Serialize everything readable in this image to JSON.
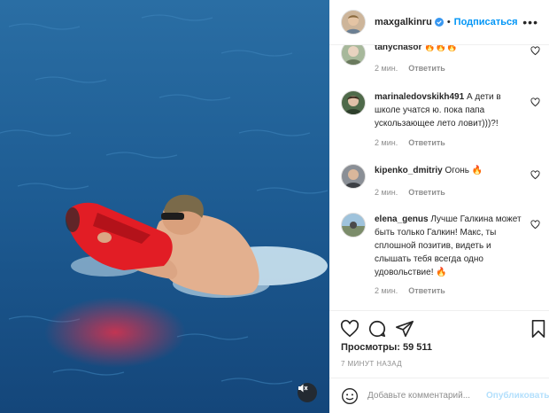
{
  "post": {
    "author": "maxgalkinru",
    "separator": "•",
    "follow_label": "Подписаться",
    "more_label": "•••"
  },
  "comments": [
    {
      "user": "tanychasor",
      "text": "🔥🔥🔥",
      "time": "2 мин.",
      "reply": "Ответить"
    },
    {
      "user": "marinaledovskikh491",
      "text": "А дети в школе учатся ю. пока папа ускользающее лето ловит)))?!",
      "time": "2 мин.",
      "reply": "Ответить"
    },
    {
      "user": "kipenko_dmitriy",
      "text": "Огонь 🔥",
      "time": "2 мин.",
      "reply": "Ответить"
    },
    {
      "user": "elena_genus",
      "text": "Лучше Галкина может быть только Галкин! Макс, ты сплошной позитив, видеть и слышать тебя всегда одно удовольствие! 🔥",
      "time": "2 мин.",
      "reply": "Ответить"
    }
  ],
  "stats": {
    "views_label": "Просмотры:",
    "views_value": "59 511",
    "posted": "7 МИНУТ НАЗАД"
  },
  "add_comment": {
    "placeholder": "Добавьте комментарий...",
    "publish_label": "Опубликовать"
  },
  "icons": {
    "verified": "verified-badge-icon",
    "like": "heart-outline-icon",
    "comment": "speech-bubble-icon",
    "share": "paper-plane-icon",
    "save": "bookmark-icon",
    "emoji": "smiley-icon",
    "mute": "speaker-muted-icon"
  },
  "colors": {
    "accent": "#0095f6",
    "muted_text": "#8e8e8e",
    "publish_disabled": "#b2dffc"
  }
}
